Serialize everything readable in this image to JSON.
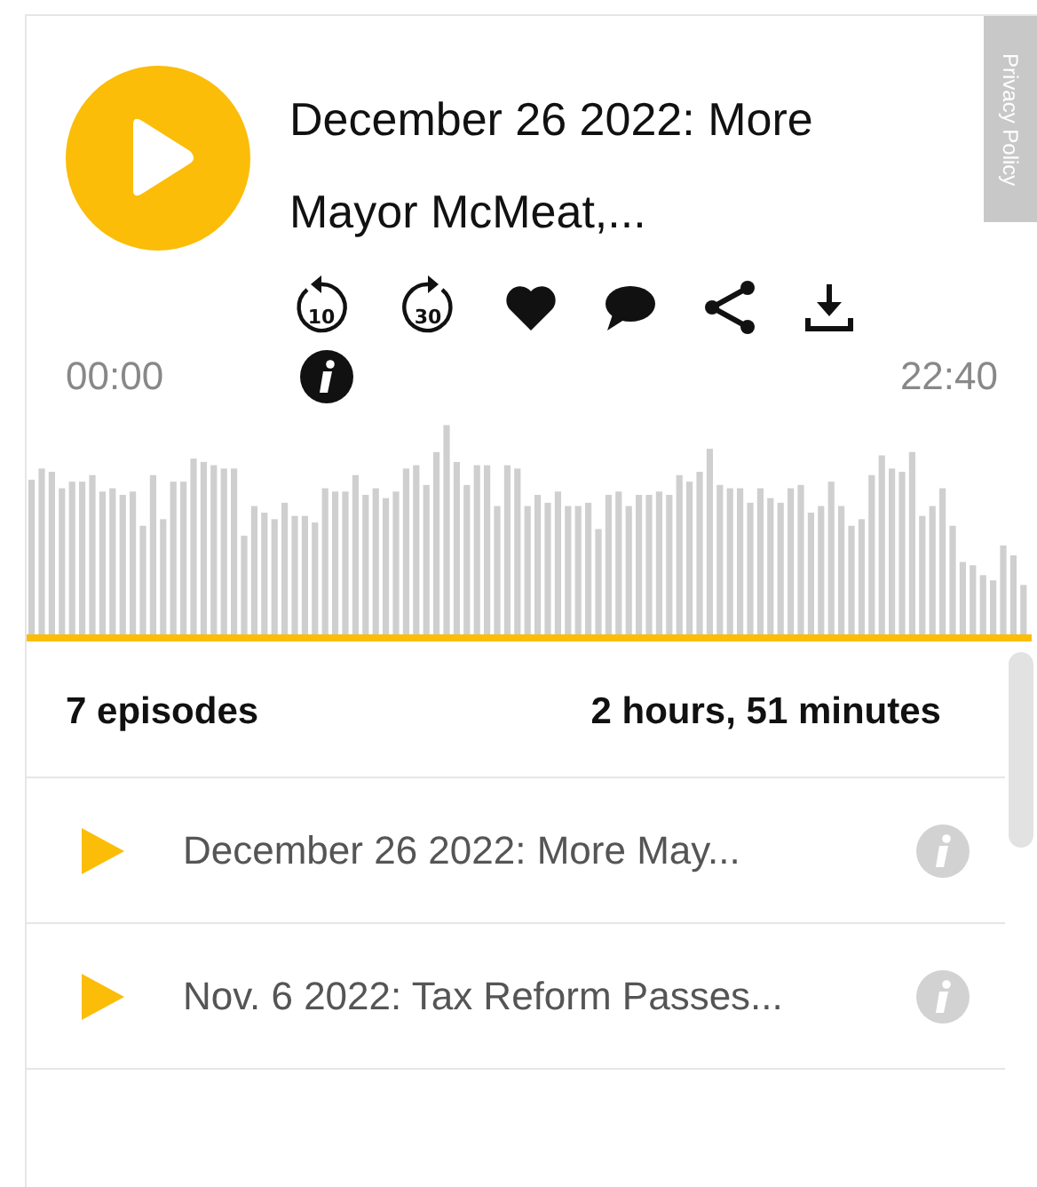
{
  "privacy_tab": {
    "label": "Privacy Policy"
  },
  "player": {
    "title": "December 26 2022: More Mayor McMeat,...",
    "skip_back_label": "10",
    "skip_forward_label": "30",
    "current_time": "00:00",
    "duration": "22:40"
  },
  "summary": {
    "episodes": "7 episodes",
    "total_duration": "2 hours, 51 minutes"
  },
  "episodes": [
    {
      "title": "December 26 2022: More May..."
    },
    {
      "title": "Nov. 6 2022: Tax Reform Passes..."
    }
  ]
}
